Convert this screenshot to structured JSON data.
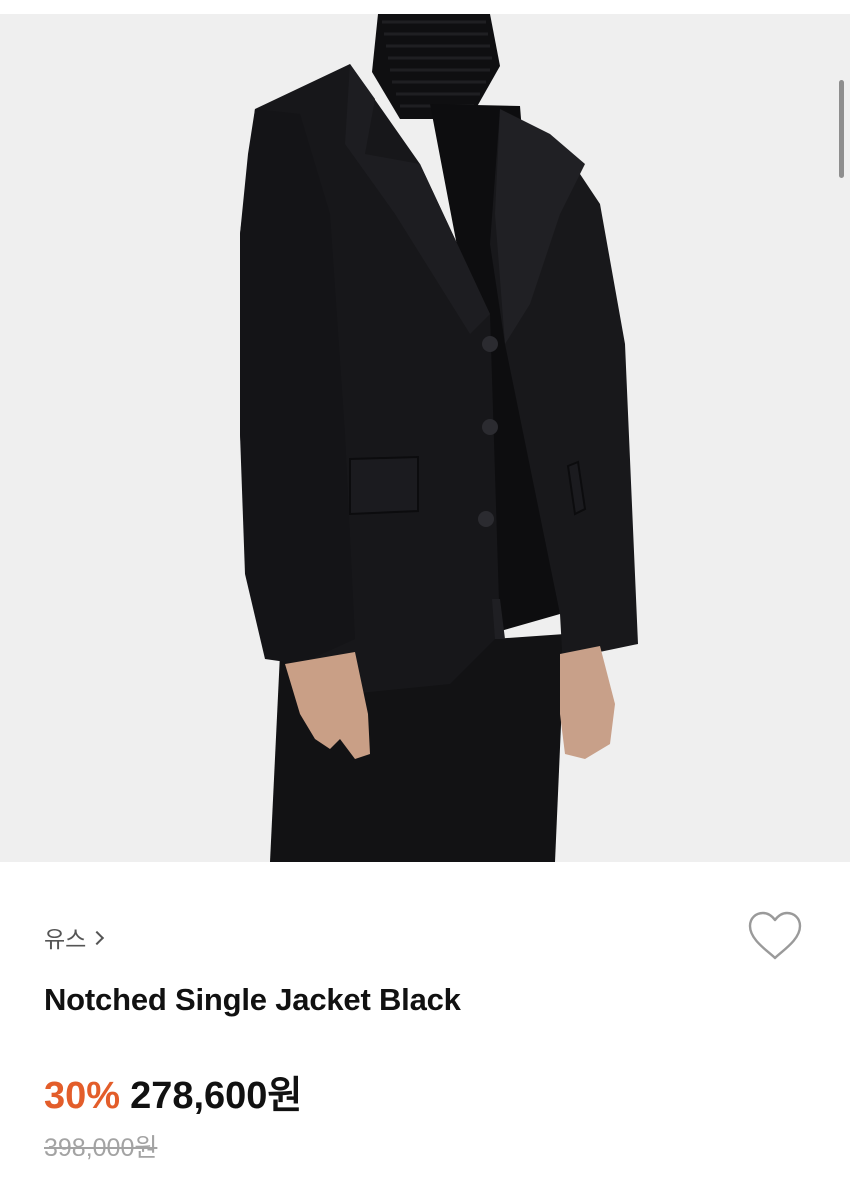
{
  "product": {
    "image_label": "black notched single jacket product photo",
    "brand": "유스",
    "title": "Notched Single Jacket Black",
    "discount": "30%",
    "sale_price": "278,600원",
    "original_price": "398,000원"
  },
  "colors": {
    "discount": "#e35d2a",
    "background": "#efefef",
    "jacket": "#151518"
  }
}
